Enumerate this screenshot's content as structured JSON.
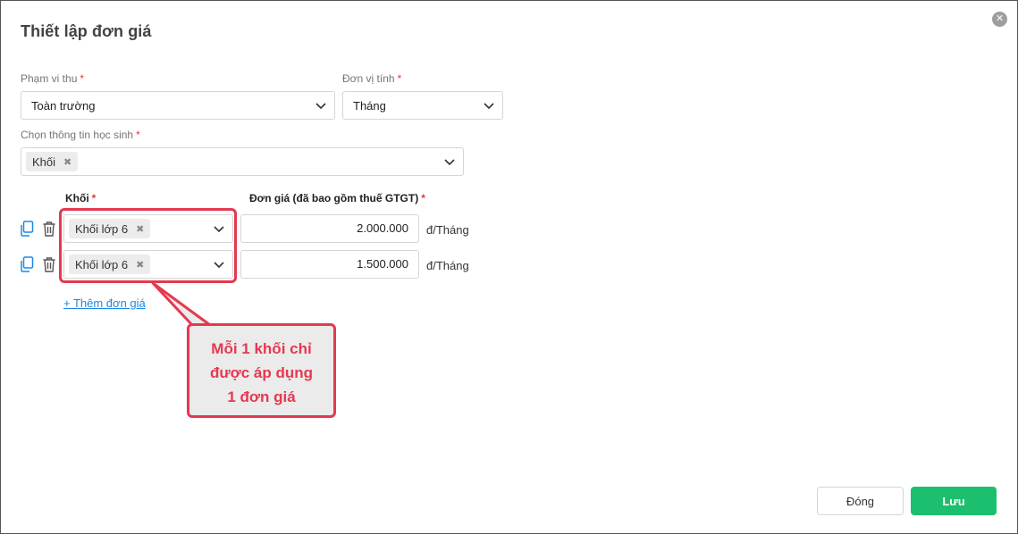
{
  "dialog": {
    "title": "Thiết lập đơn giá",
    "close_icon": "close-circle-icon"
  },
  "pham_vi_thu": {
    "label": "Phạm vi thu",
    "required_mark": "*",
    "value": "Toàn trường"
  },
  "don_vi_tinh": {
    "label": "Đơn vị tính",
    "required_mark": "*",
    "value": "Tháng"
  },
  "thong_tin_hoc_sinh": {
    "label": "Chọn thông tin học sinh",
    "required_mark": "*",
    "tags": [
      "Khối"
    ]
  },
  "table": {
    "col_khoi": {
      "label": "Khối",
      "required_mark": "*"
    },
    "col_don_gia": {
      "label": "Đơn giá (đã bao gồm thuế GTGT)",
      "required_mark": "*"
    },
    "rows": [
      {
        "khoi_tag": "Khối lớp 6",
        "don_gia": "2.000.000",
        "unit": "đ/Tháng"
      },
      {
        "khoi_tag": "Khối lớp 6",
        "don_gia": "1.500.000",
        "unit": "đ/Tháng"
      }
    ],
    "row_icons": [
      "copy-icon",
      "trash-icon"
    ]
  },
  "add_price_link": "+ Thêm đơn giá",
  "callout": {
    "lines": [
      "Mỗi 1 khối chỉ",
      "được áp dụng",
      "1 đơn giá"
    ]
  },
  "footer": {
    "close_label": "Đóng",
    "save_label": "Lưu"
  },
  "colors": {
    "accent_green": "#1cbf6d",
    "required_red": "#e53935",
    "annotation_red": "#e53950",
    "link_blue": "#1e88e5"
  }
}
